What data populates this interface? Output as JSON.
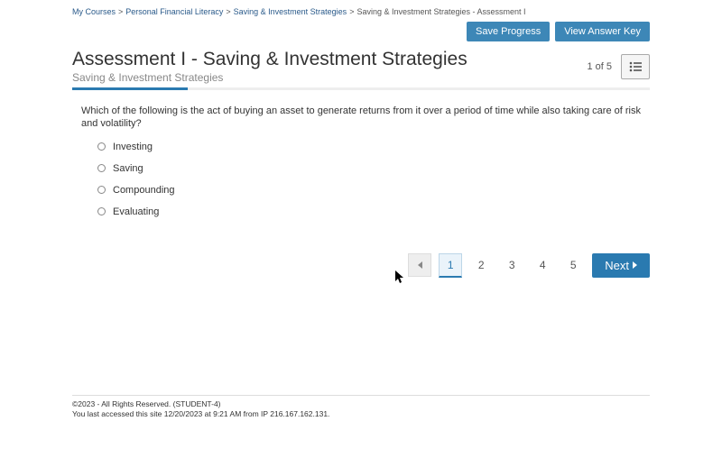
{
  "breadcrumb": {
    "items": [
      "My Courses",
      "Personal Financial Literacy",
      "Saving & Investment Strategies"
    ],
    "current": "Saving & Investment Strategies - Assessment I"
  },
  "buttons": {
    "save": "Save Progress",
    "answerKey": "View Answer Key",
    "next": "Next"
  },
  "header": {
    "title": "Assessment I - Saving & Investment Strategies",
    "subtitle": "Saving & Investment Strategies",
    "counter": "1 of 5"
  },
  "progress": {
    "percent": 20
  },
  "question": "Which of the following is the act of buying an asset to generate returns from it over a period of time while also taking care of risk and volatility?",
  "options": [
    "Investing",
    "Saving",
    "Compounding",
    "Evaluating"
  ],
  "pager": {
    "pages": [
      "1",
      "2",
      "3",
      "4",
      "5"
    ],
    "active": "1"
  },
  "footer": {
    "line1": "©2023 - All Rights Reserved. (STUDENT-4)",
    "line2": "You last accessed this site 12/20/2023 at 9:21 AM from IP 216.167.162.131."
  }
}
